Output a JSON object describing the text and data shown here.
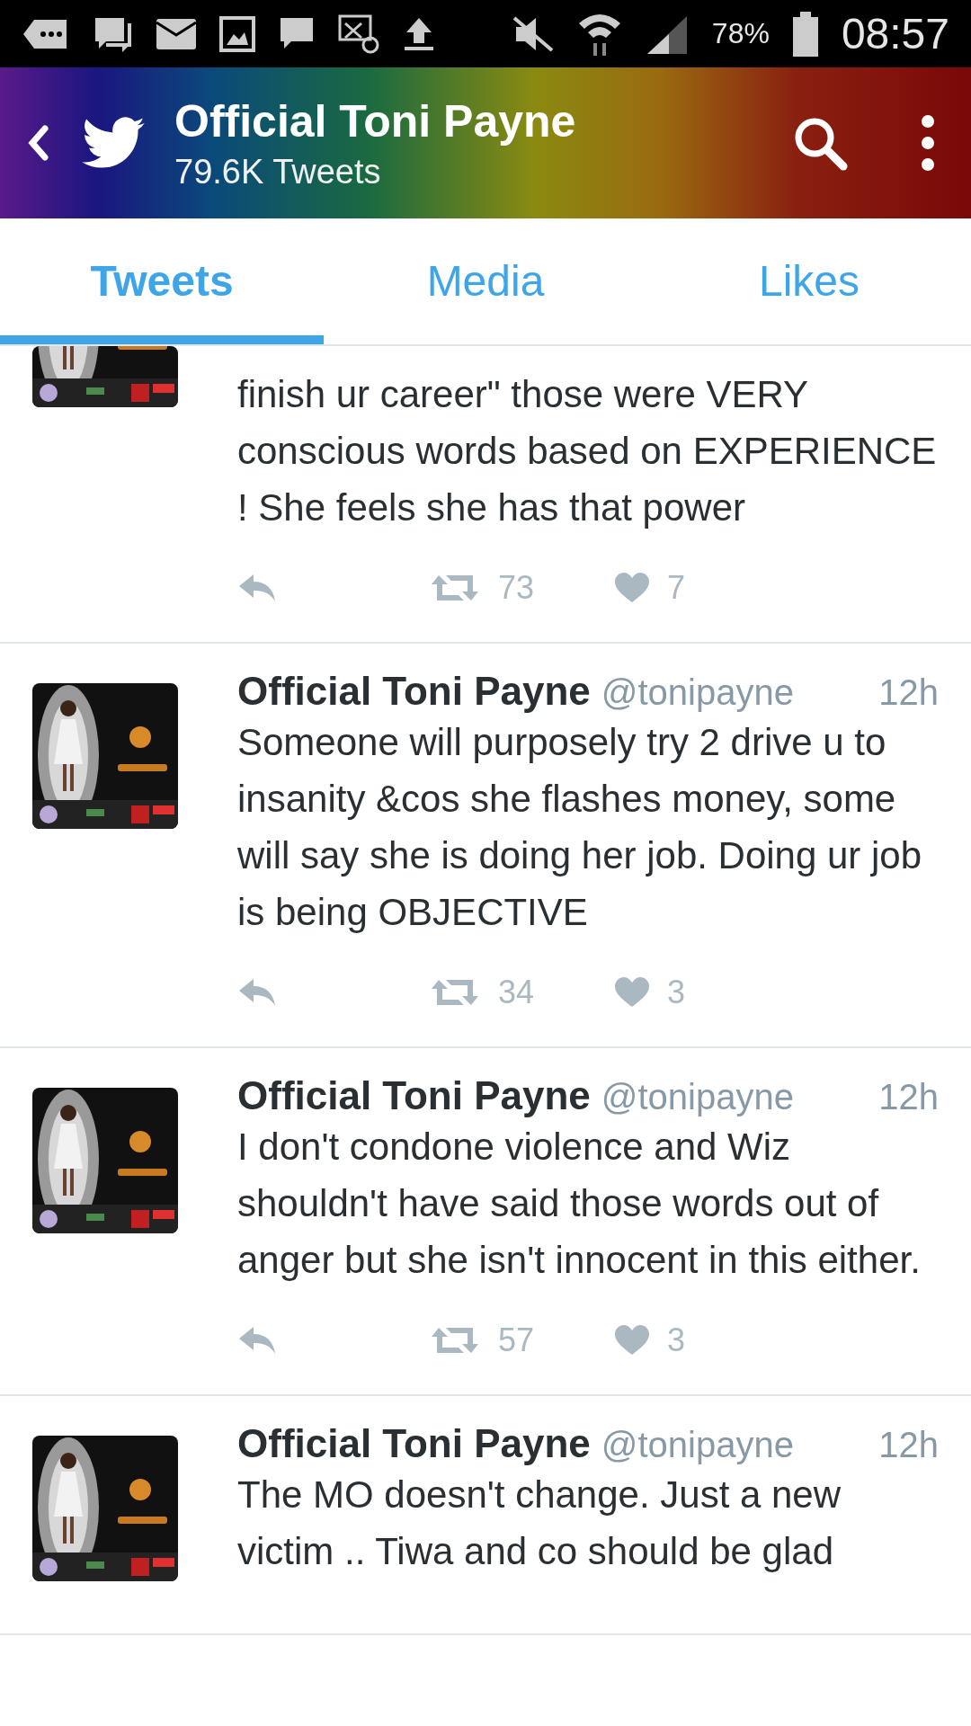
{
  "status_bar": {
    "battery": "78%",
    "time": "08:57"
  },
  "header": {
    "title": "Official Toni Payne",
    "subtitle": "79.6K Tweets"
  },
  "tabs": [
    {
      "label": "Tweets",
      "selected": true
    },
    {
      "label": "Media",
      "selected": false
    },
    {
      "label": "Likes",
      "selected": false
    }
  ],
  "tweets": [
    {
      "kind": "cut",
      "text": "finish ur career\" those were VERY conscious words based on EXPERIENCE ! She feels she has that power",
      "retweets": "73",
      "likes": "7"
    },
    {
      "kind": "full",
      "name": "Official Toni Payne",
      "handle": "@tonipayne",
      "time": "12h",
      "text": "Someone will purposely try 2 drive u to insanity &cos she flashes money, some will say she is doing her job. Doing ur job is being OBJECTIVE",
      "retweets": "34",
      "likes": "3"
    },
    {
      "kind": "full",
      "name": "Official Toni Payne",
      "handle": "@tonipayne",
      "time": "12h",
      "text": "I don't condone violence and Wiz shouldn't have said those words out of anger but she isn't innocent in this either.",
      "retweets": "57",
      "likes": "3"
    },
    {
      "kind": "bottom",
      "name": "Official Toni Payne",
      "handle": "@tonipayne",
      "time": "12h",
      "text": "The MO doesn't change. Just a new victim .. Tiwa and co should be glad"
    }
  ]
}
